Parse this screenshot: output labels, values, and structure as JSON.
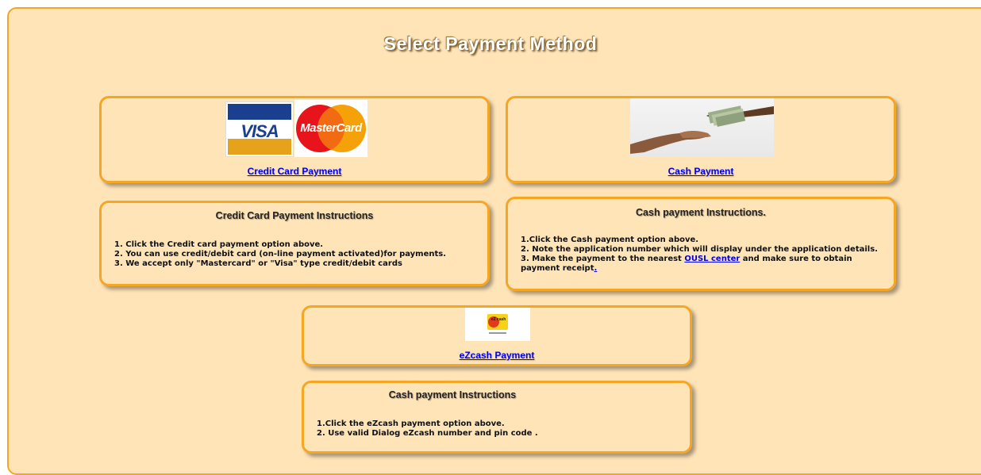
{
  "page": {
    "title": "Select Payment Method"
  },
  "credit_card": {
    "logos": [
      "visa-logo",
      "mastercard-logo"
    ],
    "visa_text": "VISA",
    "mastercard_text": "MasterCard",
    "link": "Credit Card Payment"
  },
  "cash": {
    "image": "cash-hands-image",
    "link": "Cash Payment"
  },
  "credit_instructions": {
    "heading": "Credit Card Payment Instructions",
    "lines": [
      "1. Click the Credit card payment option above.",
      "2. You can use credit/debit card (on-line payment activated)for payments.",
      "3. We accept only \"Mastercard\" or \"Visa\" type credit/debit cards"
    ]
  },
  "cash_instructions": {
    "heading": "Cash payment Instructions.",
    "line1": "1.Click the Cash payment option above.",
    "line2": "2. Note the application number which will display under the application details.",
    "line3_pre": "3. Make the payment to the nearest ",
    "line3_link": "OUSL center",
    "line3_post": " and make sure to obtain",
    "line4_pre": "payment receipt",
    "line4_link": "."
  },
  "ezcash": {
    "image": "ezcash-logo",
    "logo_text": "eZ cash",
    "link": "eZcash Payment"
  },
  "ezcash_instructions": {
    "heading": "Cash payment Instructions",
    "lines": [
      "1.Click the eZcash payment option above.",
      "2. Use valid Dialog eZcash number and pin code ."
    ]
  },
  "colors": {
    "background": "#ffe4b8",
    "border": "#f5a623",
    "link": "#0000ee"
  }
}
